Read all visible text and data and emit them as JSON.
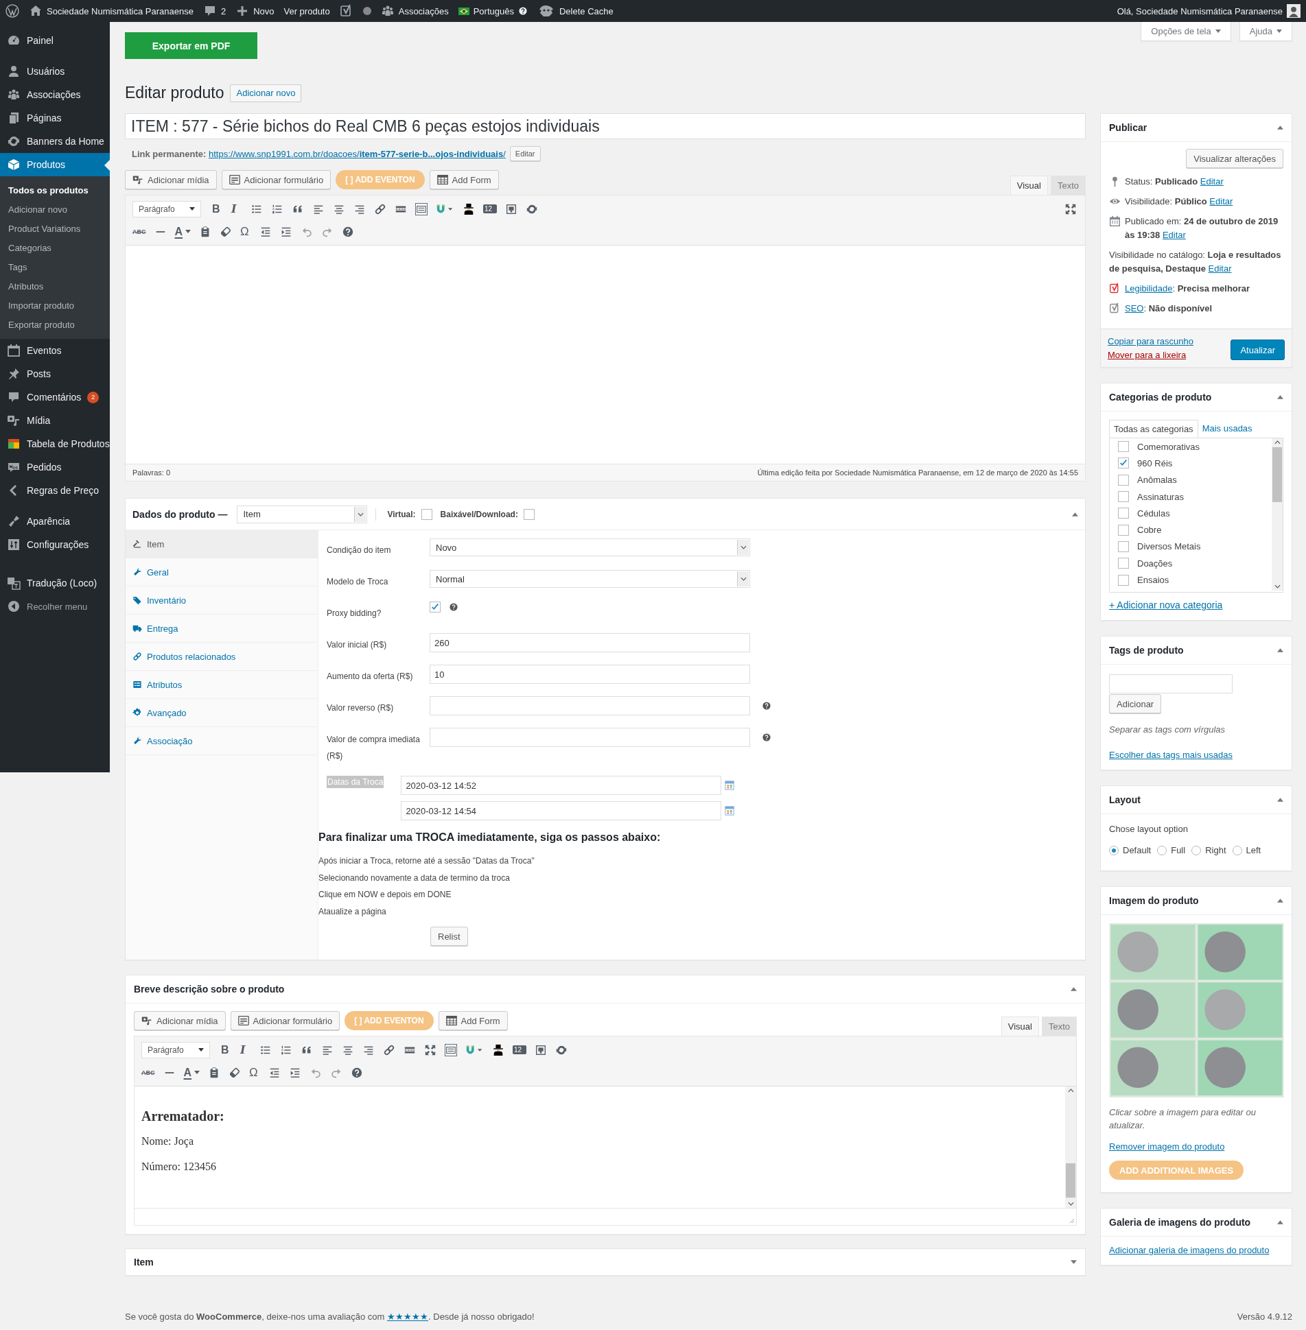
{
  "admin_bar": {
    "site": "Sociedade Numismática Paranaense",
    "comments": "2",
    "new": "Novo",
    "view": "Ver produto",
    "associations": "Associações",
    "language": "Português",
    "cache": "Delete Cache",
    "greeting": "Olá, Sociedade Numismática Paranaense"
  },
  "sidebar": {
    "groups": [
      {
        "items": [
          {
            "label": "Painel",
            "selected": false
          }
        ]
      },
      {
        "items": [
          {
            "label": "Usuários",
            "selected": false
          },
          {
            "label": "Associações",
            "selected": false
          },
          {
            "label": "Páginas",
            "selected": false
          },
          {
            "label": "Banners da Home",
            "selected": false
          },
          {
            "label": "Produtos",
            "selected": true,
            "children": [
              {
                "label": "Todos os produtos",
                "selected": true
              },
              {
                "label": "Adicionar novo",
                "selected": false
              },
              {
                "label": "Product Variations",
                "selected": false
              },
              {
                "label": "Categorias",
                "selected": false
              },
              {
                "label": "Tags",
                "selected": false
              },
              {
                "label": "Atributos",
                "selected": false
              },
              {
                "label": "Importar produto",
                "selected": false
              },
              {
                "label": "Exportar produto",
                "selected": false
              }
            ]
          },
          {
            "label": "Eventos",
            "selected": false
          },
          {
            "label": "Posts",
            "selected": false
          },
          {
            "label": "Comentários",
            "selected": false,
            "badge": "2"
          },
          {
            "label": "Mídia",
            "selected": false
          },
          {
            "label": "Tabela de Produtos",
            "selected": false
          },
          {
            "label": "Pedidos",
            "selected": false
          },
          {
            "label": "Regras de Preço",
            "selected": false
          }
        ]
      },
      {
        "items": [
          {
            "label": "Aparência",
            "selected": false
          },
          {
            "label": "Configurações",
            "selected": false
          }
        ]
      },
      {
        "items": [
          {
            "label": "Tradução (Loco)",
            "selected": false
          },
          {
            "label": "Recolher menu",
            "selected": false,
            "kind": "collapse"
          }
        ]
      }
    ]
  },
  "export_button": "Exportar em PDF",
  "screen_options": "Opções de tela",
  "help_tab": "Ajuda",
  "heading": "Editar produto",
  "add_new": "Adicionar novo",
  "title": "ITEM : 577 - Série bichos do Real CMB 6 peças estojos individuais",
  "permalink": {
    "label": "Link permanente:",
    "url": "https://www.snp1991.com.br/doacoes/**item-577-serie-b...ojos-individuais**/",
    "edit": "Editar"
  },
  "editor": {
    "media_buttons": [
      {
        "kind": "media",
        "label": "Adicionar mídia"
      },
      {
        "kind": "form",
        "label": "Adicionar formulário"
      },
      {
        "kind": "eventon",
        "label": "[ ] ADD EVENTON"
      },
      {
        "kind": "addform",
        "label": "Add Form"
      }
    ],
    "tabs": [
      {
        "label": "Visual",
        "selected": true
      },
      {
        "label": "Texto",
        "selected": false
      }
    ],
    "format": "Parágrafo",
    "distraction_free": true,
    "row1": [
      {
        "kind": "bold",
        "text": "B"
      },
      {
        "kind": "italic",
        "text": "I"
      },
      {
        "kind": "bullets"
      },
      {
        "kind": "numbers"
      },
      {
        "kind": "quote"
      },
      {
        "kind": "alignleft"
      },
      {
        "kind": "aligncenter"
      },
      {
        "kind": "alignright"
      },
      {
        "kind": "link"
      },
      {
        "kind": "more"
      },
      {
        "kind": "keyboard"
      },
      {
        "kind": "magnet"
      },
      {
        "kind": "person"
      },
      {
        "kind": "badge",
        "text": "12"
      },
      {
        "kind": "frame"
      },
      {
        "kind": "refresh"
      }
    ],
    "row2": [
      {
        "kind": "strike",
        "text": "ABC"
      },
      {
        "kind": "hr"
      },
      {
        "kind": "color",
        "text": "A"
      },
      {
        "kind": "paste"
      },
      {
        "kind": "eraser"
      },
      {
        "kind": "omega",
        "text": "Ω"
      },
      {
        "kind": "outdent"
      },
      {
        "kind": "indent"
      },
      {
        "kind": "undo"
      },
      {
        "kind": "redo"
      },
      {
        "kind": "help"
      }
    ],
    "words": "Palavras: 0",
    "last_edit": "Última edição feita por Sociedade Numismática Paranaense, em 12 de março de 2020 às 14:55"
  },
  "product_data": {
    "title": "Dados do produto —",
    "type": "Item",
    "virtual": {
      "label": "Virtual:",
      "checked": false
    },
    "download": {
      "label": "Baixável/Download:",
      "checked": false
    },
    "tabs": [
      {
        "label": "Item",
        "selected": true
      },
      {
        "label": "Geral",
        "selected": false
      },
      {
        "label": "Inventário",
        "selected": false
      },
      {
        "label": "Entrega",
        "selected": false
      },
      {
        "label": "Produtos relacionados",
        "selected": false
      },
      {
        "label": "Atributos",
        "selected": false
      },
      {
        "label": "Avançado",
        "selected": false
      },
      {
        "label": "Associação",
        "selected": false
      }
    ],
    "fields": [
      {
        "kind": "select",
        "label": "Condição do item",
        "value": "Novo"
      },
      {
        "kind": "select",
        "label": "Modelo de Troca",
        "value": "Normal"
      },
      {
        "kind": "checkbox",
        "label": "Proxy bidding?",
        "checked": true,
        "help": true
      },
      {
        "kind": "text",
        "label": "Valor inicial (R$)",
        "value": "260"
      },
      {
        "kind": "text",
        "label": "Aumento da oferta (R$)",
        "value": "10"
      },
      {
        "kind": "text",
        "label": "Valor reverso (R$)",
        "help": true
      },
      {
        "kind": "text",
        "label": "Valor de compra imediata (R$)",
        "help": true
      },
      {
        "kind": "dates",
        "label": "Datas da Troca",
        "highlighted": true,
        "values": [
          "2020-03-12 14:52",
          "2020-03-12 14:54"
        ]
      }
    ],
    "steps_title": "Para finalizar uma TROCA imediatamente, siga os passos abaixo:",
    "steps": [
      "Após iniciar a Troca, retorne até a sessão \"Datas da Troca\"",
      "Selecionando novamente a data de termino da troca",
      "Clique em NOW e depois em DONE",
      "Ataualize a página"
    ],
    "relist": "Relist"
  },
  "short_description": {
    "title": "Breve descrição sobre o produto",
    "editor": {
      "media_buttons": [
        {
          "kind": "media",
          "label": "Adicionar mídia"
        },
        {
          "kind": "form",
          "label": "Adicionar formulário"
        },
        {
          "kind": "eventon",
          "label": "[ ] ADD EVENTON"
        },
        {
          "kind": "addform",
          "label": "Add Form"
        }
      ],
      "tabs": [
        {
          "label": "Visual",
          "selected": true
        },
        {
          "label": "Texto",
          "selected": false
        }
      ],
      "format": "Parágrafo",
      "row1": [
        {
          "kind": "bold",
          "text": "B"
        },
        {
          "kind": "italic",
          "text": "I"
        },
        {
          "kind": "bullets"
        },
        {
          "kind": "numbers"
        },
        {
          "kind": "quote"
        },
        {
          "kind": "alignleft"
        },
        {
          "kind": "aligncenter"
        },
        {
          "kind": "alignright"
        },
        {
          "kind": "link"
        },
        {
          "kind": "more"
        },
        {
          "kind": "fullscreen"
        },
        {
          "kind": "keyboard"
        },
        {
          "kind": "magnet"
        },
        {
          "kind": "person"
        },
        {
          "kind": "badge",
          "text": "12"
        },
        {
          "kind": "frame"
        },
        {
          "kind": "refresh"
        }
      ],
      "row2": [
        {
          "kind": "strike",
          "text": "ABC"
        },
        {
          "kind": "hr"
        },
        {
          "kind": "color",
          "text": "A"
        },
        {
          "kind": "paste"
        },
        {
          "kind": "eraser"
        },
        {
          "kind": "omega",
          "text": "Ω"
        },
        {
          "kind": "outdent"
        },
        {
          "kind": "indent"
        },
        {
          "kind": "undo"
        },
        {
          "kind": "redo"
        },
        {
          "kind": "help"
        }
      ],
      "content": [
        {
          "kind": "heading",
          "text": "Arrematador:"
        },
        {
          "kind": "paragraph",
          "text": "Nome: Joça"
        },
        {
          "kind": "paragraph",
          "text": "Número: 123456"
        }
      ]
    }
  },
  "item_box": {
    "title": "Item"
  },
  "publish": {
    "title": "Publicar",
    "preview": "Visualizar alterações",
    "rows": [
      {
        "kind": "status",
        "text": "Status: **Publicado**",
        "link": "Editar"
      },
      {
        "kind": "visibility",
        "text": "Visibilidade: **Público**",
        "link": "Editar"
      },
      {
        "kind": "date",
        "text": "Publicado em: **24 de outubro de 2019 às 19:38**",
        "link": "Editar"
      },
      {
        "kind": "catalog",
        "text": "Visibilidade no catálogo: **Loja e resultados de pesquisa, Destaque**",
        "link": "Editar"
      },
      {
        "kind": "yoast",
        "link": "Legibilidade",
        "text": ": **Precisa melhorar**",
        "color": "#dc3232"
      },
      {
        "kind": "yoast",
        "link": "SEO",
        "text": ": **Não disponível**",
        "color": "#888888"
      }
    ],
    "copy": "Copiar para rascunho",
    "trash": "Mover para a lixeira",
    "update": "Atualizar"
  },
  "categories": {
    "title": "Categorias de produto",
    "tabs": [
      {
        "label": "Todas as categorias",
        "selected": true
      },
      {
        "label": "Mais usadas",
        "selected": false
      }
    ],
    "items": [
      {
        "label": "Comemorativas",
        "checked": false
      },
      {
        "label": "960 Réis",
        "checked": true
      },
      {
        "label": "Anômalas",
        "checked": false
      },
      {
        "label": "Assinaturas",
        "checked": false
      },
      {
        "label": "Cédulas",
        "checked": false
      },
      {
        "label": "Cobre",
        "checked": false
      },
      {
        "label": "Diversos Metais",
        "checked": false
      },
      {
        "label": "Doações",
        "checked": false
      },
      {
        "label": "Ensaios",
        "checked": false
      }
    ],
    "add": "+ Adicionar nova categoria"
  },
  "tags": {
    "title": "Tags de produto",
    "add": "Adicionar",
    "hint": "Separar as tags com vírgulas",
    "choose": "Escolher das tags mais usadas"
  },
  "layout": {
    "title": "Layout",
    "prompt": "Chose layout option",
    "options": [
      {
        "label": "Default",
        "selected": true
      },
      {
        "label": "Full",
        "selected": false
      },
      {
        "label": "Right",
        "selected": false
      },
      {
        "label": "Left",
        "selected": false
      }
    ]
  },
  "product_image": {
    "title": "Imagem do produto",
    "hint": "Clicar sobre a imagem para editar ou atualizar.",
    "remove": "Remover imagem do produto",
    "more": "ADD ADDITIONAL IMAGES"
  },
  "gallery": {
    "title": "Galeria de imagens do produto",
    "add": "Adicionar galeria de imagens do produto"
  },
  "footer": {
    "before": "Se você gosta do **WooCommerce**, deixe-nos uma avaliação com ",
    "stars": "★★★★★",
    "after": ". Desde já nosso obrigado!",
    "version": "Versão 4.9.12"
  }
}
